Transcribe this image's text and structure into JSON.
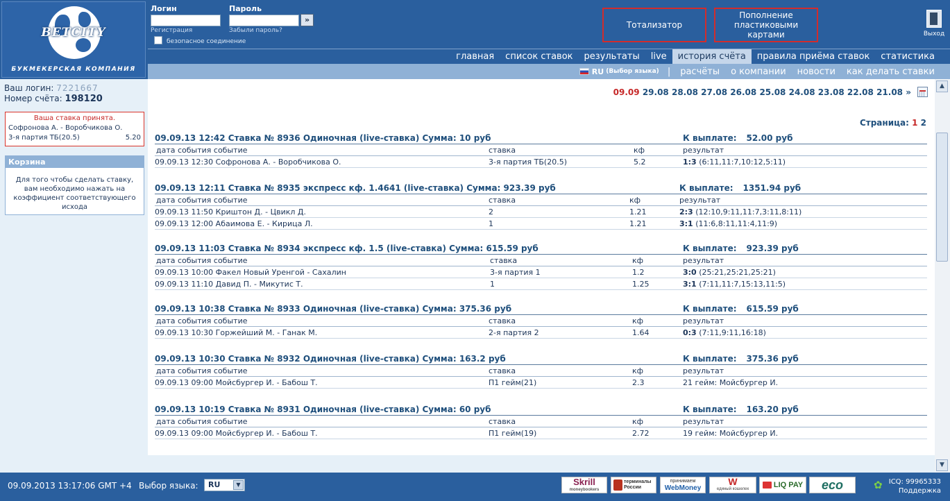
{
  "header": {
    "logo": {
      "brand": "BETCITY",
      "subtitle": "БУКМЕКЕРСКАЯ КОМПАНИЯ"
    },
    "login_label": "Логин",
    "password_label": "Пароль",
    "register_link": "Регистрация",
    "forgot_link": "Забыли пароль?",
    "go_button": "»",
    "secure_label": "безопасное соединение",
    "promo_totalizator": "Тотализатор",
    "promo_cards": "Пополнение пластиковыми картами",
    "exit_label": "Выход"
  },
  "nav_main": [
    {
      "label": "главная",
      "active": false
    },
    {
      "label": "список ставок",
      "active": false
    },
    {
      "label": "результаты",
      "active": false
    },
    {
      "label": "live",
      "active": false
    },
    {
      "label": "история счёта",
      "active": true
    },
    {
      "label": "правила приёма ставок",
      "active": false
    },
    {
      "label": "статистика",
      "active": false
    }
  ],
  "nav_secondary": {
    "lang_code": "RU",
    "lang_hint": "(Выбор языка)",
    "separator": "|",
    "items": [
      "расчёты",
      "о компании",
      "новости",
      "как делать ставки"
    ]
  },
  "account": {
    "login_label": "Ваш логин:",
    "login_value": "7221667",
    "number_label": "Номер счёта:",
    "number_value": "198120"
  },
  "accepted_bet": {
    "title": "Ваша ставка принята.",
    "event": "Софронова А. - Воробчикова О.",
    "bet": "3-я партия ТБ(20.5)",
    "odds": "5.20"
  },
  "basket": {
    "title": "Корзина",
    "text": "Для того чтобы сделать ставку, вам необходимо нажать на коэффициент соответствующего исхода"
  },
  "dates": {
    "current": "09.09",
    "others": [
      "29.08",
      "28.08",
      "27.08",
      "26.08",
      "25.08",
      "24.08",
      "23.08",
      "22.08",
      "21.08"
    ],
    "more": "»"
  },
  "pages": {
    "label": "Страница:",
    "current": "1",
    "next": "2"
  },
  "columns": {
    "event": "дата события событие",
    "bet": "ставка",
    "odds": "кф",
    "result": "результат"
  },
  "payout_label": "К выплате:",
  "bets": [
    {
      "title": "09.09.13 12:42  Ставка № 8936  Одиночная (live-ставка)  Сумма: 10 руб",
      "payout": "52.00 руб",
      "rows": [
        {
          "event": "09.09.13 12:30 Софронова А. - Воробчикова О.",
          "bet": "3-я партия ТБ(20.5)",
          "odds": "5.2",
          "score": "1:3",
          "detail": " (6:11,11:7,10:12,5:11)"
        }
      ]
    },
    {
      "title": "09.09.13 12:11  Ставка № 8935  экспресс кф. 1.4641 (live-ставка)  Сумма: 923.39 руб",
      "payout": "1351.94 руб",
      "rows": [
        {
          "event": "09.09.13 11:50 Криштон Д. - Цвикл Д.",
          "bet": "2",
          "odds": "1.21",
          "score": "2:3",
          "detail": " (12:10,9:11,11:7,3:11,8:11)"
        },
        {
          "event": "09.09.13 12:00 Абаимова Е. - Кирица Л.",
          "bet": "1",
          "odds": "1.21",
          "score": "3:1",
          "detail": " (11:6,8:11,11:4,11:9)"
        }
      ]
    },
    {
      "title": "09.09.13 11:03  Ставка № 8934  экспресс кф. 1.5 (live-ставка)  Сумма: 615.59 руб",
      "payout": "923.39 руб",
      "rows": [
        {
          "event": "09.09.13 10:00 Факел Новый Уренгой - Сахалин",
          "bet": "3-я партия 1",
          "odds": "1.2",
          "score": "3:0",
          "detail": " (25:21,25:21,25:21)"
        },
        {
          "event": "09.09.13 11:10 Давид П. - Микутис Т.",
          "bet": "1",
          "odds": "1.25",
          "score": "3:1",
          "detail": " (7:11,11:7,15:13,11:5)"
        }
      ]
    },
    {
      "title": "09.09.13 10:38  Ставка № 8933  Одиночная (live-ставка)  Сумма: 375.36 руб",
      "payout": "615.59 руб",
      "rows": [
        {
          "event": "09.09.13 10:30 Горжейший М. - Ганак М.",
          "bet": "2-я партия 2",
          "odds": "1.64",
          "score": "0:3",
          "detail": " (7:11,9:11,16:18)"
        }
      ]
    },
    {
      "title": "09.09.13 10:30  Ставка № 8932  Одиночная (live-ставка)  Сумма: 163.2 руб",
      "payout": "375.36 руб",
      "rows": [
        {
          "event": "09.09.13 09:00 Мойсбургер И. - Бабош Т.",
          "bet": "П1 гейм(21)",
          "odds": "2.3",
          "score": "",
          "detail": "21 гейм: Мойсбургер И."
        }
      ]
    },
    {
      "title": "09.09.13 10:19  Ставка № 8931  Одиночная (live-ставка)  Сумма: 60 руб",
      "payout": "163.20 руб",
      "rows": [
        {
          "event": "09.09.13 09:00 Мойсбургер И. - Бабош Т.",
          "bet": "П1 гейм(19)",
          "odds": "2.72",
          "score": "",
          "detail": "19 гейм: Мойсбургер И."
        }
      ]
    }
  ],
  "footer": {
    "datetime": "09.09.2013  13:17:06  GMT +4",
    "lang_label": "Выбор языка:",
    "lang_value": "RU",
    "payments": {
      "skrill": "Skrill",
      "skrill_sub": "moneybookers",
      "terminals": "терминалы России",
      "webmoney_top": "принимаем",
      "webmoney": "WebMoney",
      "wallet": "единый кошелек",
      "liqpay": "LIQ PAY",
      "eco": "eco"
    },
    "icq": "ICQ: 99965333",
    "support": "Поддержка"
  },
  "colors": {
    "header_bg": "#2a5f9e",
    "accent_red": "#c62828",
    "text_blue": "#1f4f7c"
  }
}
